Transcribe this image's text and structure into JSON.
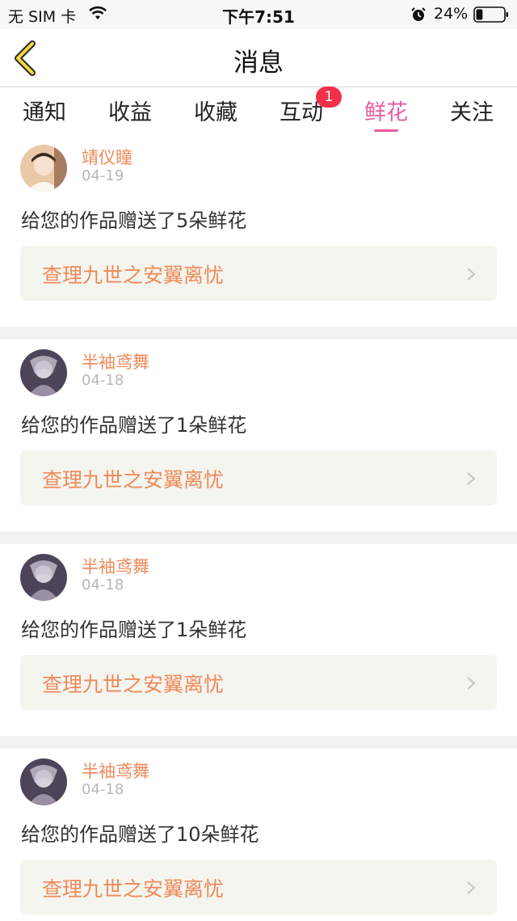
{
  "status_bar": {
    "carrier": "无 SIM 卡",
    "time": "下午7:51",
    "battery_percent": "24%",
    "battery_level": 0.24,
    "icons": [
      "wifi-icon",
      "alarm-icon",
      "battery-icon"
    ]
  },
  "header": {
    "title": "消息",
    "back_icon": "chevron-left-icon"
  },
  "tabs": [
    {
      "label": "通知",
      "active": false
    },
    {
      "label": "收益",
      "active": false
    },
    {
      "label": "收藏",
      "active": false
    },
    {
      "label": "互动",
      "active": false,
      "badge": "1"
    },
    {
      "label": "鲜花",
      "active": true
    },
    {
      "label": "关注",
      "active": false
    }
  ],
  "colors": {
    "accent": "#e75da0",
    "name": "#ee8a5a",
    "badge": "#f2304a",
    "link_bg": "#f5f5ef"
  },
  "items": [
    {
      "user": "靖仪瞳",
      "date": "04-19",
      "message": "给您的作品赠送了5朵鲜花",
      "work": "查理九世之安翼离忧"
    },
    {
      "user": "半袖鸢舞",
      "date": "04-18",
      "message": "给您的作品赠送了1朵鲜花",
      "work": "查理九世之安翼离忧"
    },
    {
      "user": "半袖鸢舞",
      "date": "04-18",
      "message": "给您的作品赠送了1朵鲜花",
      "work": "查理九世之安翼离忧"
    },
    {
      "user": "半袖鸢舞",
      "date": "04-18",
      "message": "给您的作品赠送了10朵鲜花",
      "work": "查理九世之安翼离忧"
    }
  ]
}
